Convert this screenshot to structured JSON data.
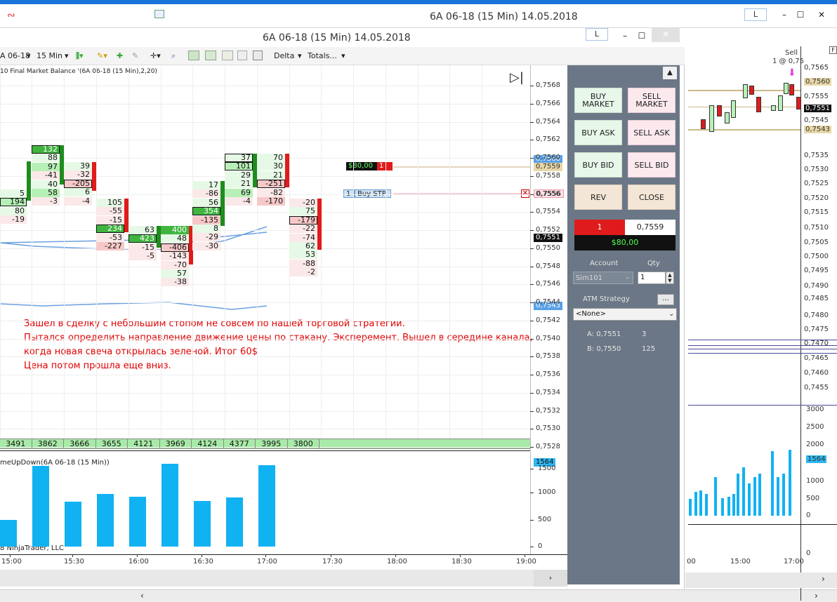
{
  "outer_window": {
    "title": "6A 06-18 (15 Min)  14.05.2018",
    "link_label": "L",
    "minimize": "–",
    "maximize": "☐",
    "close": "✕"
  },
  "inner_window": {
    "title": "6A 06-18 (15 Min)  14.05.2018",
    "link_label": "L",
    "minimize": "–",
    "maximize": "☐",
    "close": "✕"
  },
  "toolbar": {
    "instrument": "A 06-18",
    "interval": "15 Min",
    "delta": "Delta",
    "totals": "Totals..."
  },
  "indicator_label": "10 Final Market Balance  '(6A 06-18 (15 Min),2,20)",
  "volume_label": "meUpDown(6A 06-18 (15 Min))",
  "copyright": "8 NinjaTrader, LLC",
  "price_axis": [
    "0,7568",
    "0,7566",
    "0,7564",
    "0,7562",
    "0,7560",
    "0,7558",
    "0,7556",
    "0,7554",
    "0,7552",
    "0,7550",
    "0,7548",
    "0,7546",
    "0,7544",
    "0,7542",
    "0,7540",
    "0,7538",
    "0,7536",
    "0,7534",
    "0,7532",
    "0,7530",
    "0,7528"
  ],
  "price_tags": {
    "p7560": "0,7560",
    "p7559": "0,7559",
    "p7556": "0,7556",
    "p7551": "0,7551",
    "p7543": "0,7543",
    "vol1564": "1564"
  },
  "order_tags": {
    "pnl": "$80,00",
    "pnl_qty": "1",
    "stop_qty": "1",
    "stop_label": "Buy STP"
  },
  "columns": [
    {
      "cells": [
        [
          "5",
          "pos2",
          ""
        ],
        [
          "194",
          "pos",
          "boxed"
        ],
        [
          "80",
          "pos2",
          ""
        ],
        [
          "-19",
          "neg2",
          ""
        ]
      ]
    },
    {
      "cells": [
        [
          "132",
          "strong-pos",
          "boxed"
        ],
        [
          "88",
          "pos2",
          ""
        ],
        [
          "97",
          "pos",
          ""
        ],
        [
          "-41",
          "neg2",
          ""
        ],
        [
          "40",
          "pos2",
          ""
        ],
        [
          "58",
          "pos",
          ""
        ],
        [
          "-3",
          "neg2",
          ""
        ]
      ]
    },
    {
      "cells": [
        [
          "39",
          "pos2",
          ""
        ],
        [
          "-32",
          "neg2",
          ""
        ],
        [
          "-205",
          "neg",
          "boxed"
        ],
        [
          "6",
          "pos2",
          ""
        ],
        [
          "-4",
          "neg2",
          ""
        ]
      ]
    },
    {
      "cells": [
        [
          "105",
          "pos2",
          ""
        ],
        [
          "-55",
          "neg2",
          ""
        ],
        [
          "-15",
          "neg2",
          ""
        ],
        [
          "234",
          "strong-pos",
          "boxed"
        ],
        [
          "-53",
          "neg2",
          ""
        ],
        [
          "-227",
          "neg",
          ""
        ]
      ]
    },
    {
      "cells": [
        [
          "63",
          "pos2",
          ""
        ],
        [
          "423",
          "strong-pos",
          "boxed"
        ],
        [
          "-15",
          "neg2",
          ""
        ],
        [
          "-5",
          "neg2",
          ""
        ]
      ]
    },
    {
      "cells": [
        [
          "400",
          "strong-pos",
          ""
        ],
        [
          "48",
          "pos2",
          ""
        ],
        [
          "-406",
          "neg",
          "boxed"
        ],
        [
          "-143",
          "neg2",
          ""
        ],
        [
          "-70",
          "neg2",
          ""
        ],
        [
          "57",
          "pos2",
          ""
        ],
        [
          "-38",
          "neg2",
          ""
        ]
      ]
    },
    {
      "cells": [
        [
          "17",
          "pos2",
          ""
        ],
        [
          "-86",
          "neg2",
          ""
        ],
        [
          "56",
          "pos2",
          ""
        ],
        [
          "354",
          "strong-pos",
          "boxed"
        ],
        [
          "-135",
          "neg",
          ""
        ],
        [
          "8",
          "pos2",
          ""
        ],
        [
          "-29",
          "neg2",
          ""
        ],
        [
          "-30",
          "neg2",
          ""
        ]
      ]
    },
    {
      "cells": [
        [
          "37",
          "pos2",
          "boxed"
        ],
        [
          "101",
          "pos",
          "boxed"
        ],
        [
          "29",
          "pos2",
          ""
        ],
        [
          "21",
          "pos2",
          ""
        ],
        [
          "69",
          "pos",
          ""
        ],
        [
          "-4",
          "neg2",
          ""
        ]
      ]
    },
    {
      "cells": [
        [
          "70",
          "pos2",
          ""
        ],
        [
          "30",
          "pos2",
          ""
        ],
        [
          "21",
          "pos2",
          ""
        ],
        [
          "-251",
          "neg",
          "boxed"
        ],
        [
          "-82",
          "neg2",
          ""
        ],
        [
          "-170",
          "neg",
          ""
        ]
      ]
    },
    {
      "cells": [
        [
          "-20",
          "neg2",
          ""
        ],
        [
          "75",
          "pos2",
          ""
        ],
        [
          "-179",
          "neg",
          "boxed"
        ],
        [
          "-22",
          "neg2",
          ""
        ],
        [
          "-74",
          "neg2",
          ""
        ],
        [
          "62",
          "pos2",
          ""
        ],
        [
          "53",
          "pos2",
          ""
        ],
        [
          "-88",
          "neg2",
          ""
        ],
        [
          "-2",
          "neg2",
          ""
        ]
      ]
    }
  ],
  "volume_totals": [
    "3491",
    "3862",
    "3666",
    "3655",
    "4121",
    "3969",
    "4124",
    "4377",
    "3995",
    "3800"
  ],
  "volume_axis": [
    "1500",
    "1000",
    "500",
    "0"
  ],
  "time_axis": [
    "15:00",
    "15:30",
    "16:00",
    "16:30",
    "17:00",
    "17:30",
    "18:00",
    "18:30",
    "19:00"
  ],
  "volume_bars": [
    520,
    1560,
    860,
    1010,
    960,
    1590,
    880,
    950,
    1570
  ],
  "note_lines": [
    "Зашел в сделку с небольшим стопом не совсем по нашей торговой стратегии.",
    "Пытался определить направление движение цены по стакану. Эксперемент. Вышел в середине канала,",
    "когда новая свеча открылась зеленой. Итог 60$",
    "Цена потом прошла еще вниз."
  ],
  "trade_panel": {
    "buy_market": "BUY\nMARKET",
    "sell_market": "SELL\nMARKET",
    "buy_ask": "BUY ASK",
    "sell_ask": "SELL ASK",
    "buy_bid": "BUY BID",
    "sell_bid": "SELL BID",
    "rev": "REV",
    "close": "CLOSE",
    "position_qty": "1",
    "position_price": "0,7559",
    "pnl": "$80,00",
    "account_label": "Account",
    "qty_label": "Qty",
    "account_value": "Sim101",
    "qty_value": "1",
    "atm_label": "ATM Strategy",
    "atm_button": "...",
    "atm_value": "<None>",
    "ask_label": "A: 0,7551",
    "ask_size": "3",
    "bid_label": "B: 0,7550",
    "bid_size": "125"
  },
  "right_chart": {
    "sell_label": "Sell",
    "sell_fill": "1 @ 0,75",
    "price_axis": [
      "0,7565",
      "0,7560",
      "0,7555",
      "0,7551",
      "0,7545",
      "0,7543",
      "0,7535",
      "0,7530",
      "0,7525",
      "0,7520",
      "0,7515",
      "0,7510",
      "0,7505",
      "0,7500",
      "0,7495",
      "0,7490",
      "0,7485",
      "0,7480",
      "0,7475",
      "0,7470",
      "0,7465",
      "0,7460",
      "0,7455"
    ],
    "vol_axis": [
      "3000",
      "2500",
      "2000",
      "1564",
      "1000",
      "500",
      "0",
      "0"
    ],
    "time_axis": [
      "00",
      "15:00",
      "17:00"
    ],
    "vol_bars": [
      400,
      560,
      600,
      520,
      920,
      420,
      450,
      520,
      1000,
      1150,
      760,
      920,
      1000,
      1540,
      920,
      1000,
      1560
    ],
    "f_label": "F"
  },
  "colors": {
    "accent_blue": "#11b2f2",
    "up": "#22a822",
    "down": "#e01b1b",
    "panel": "#6b7786",
    "note": "#e00000"
  }
}
